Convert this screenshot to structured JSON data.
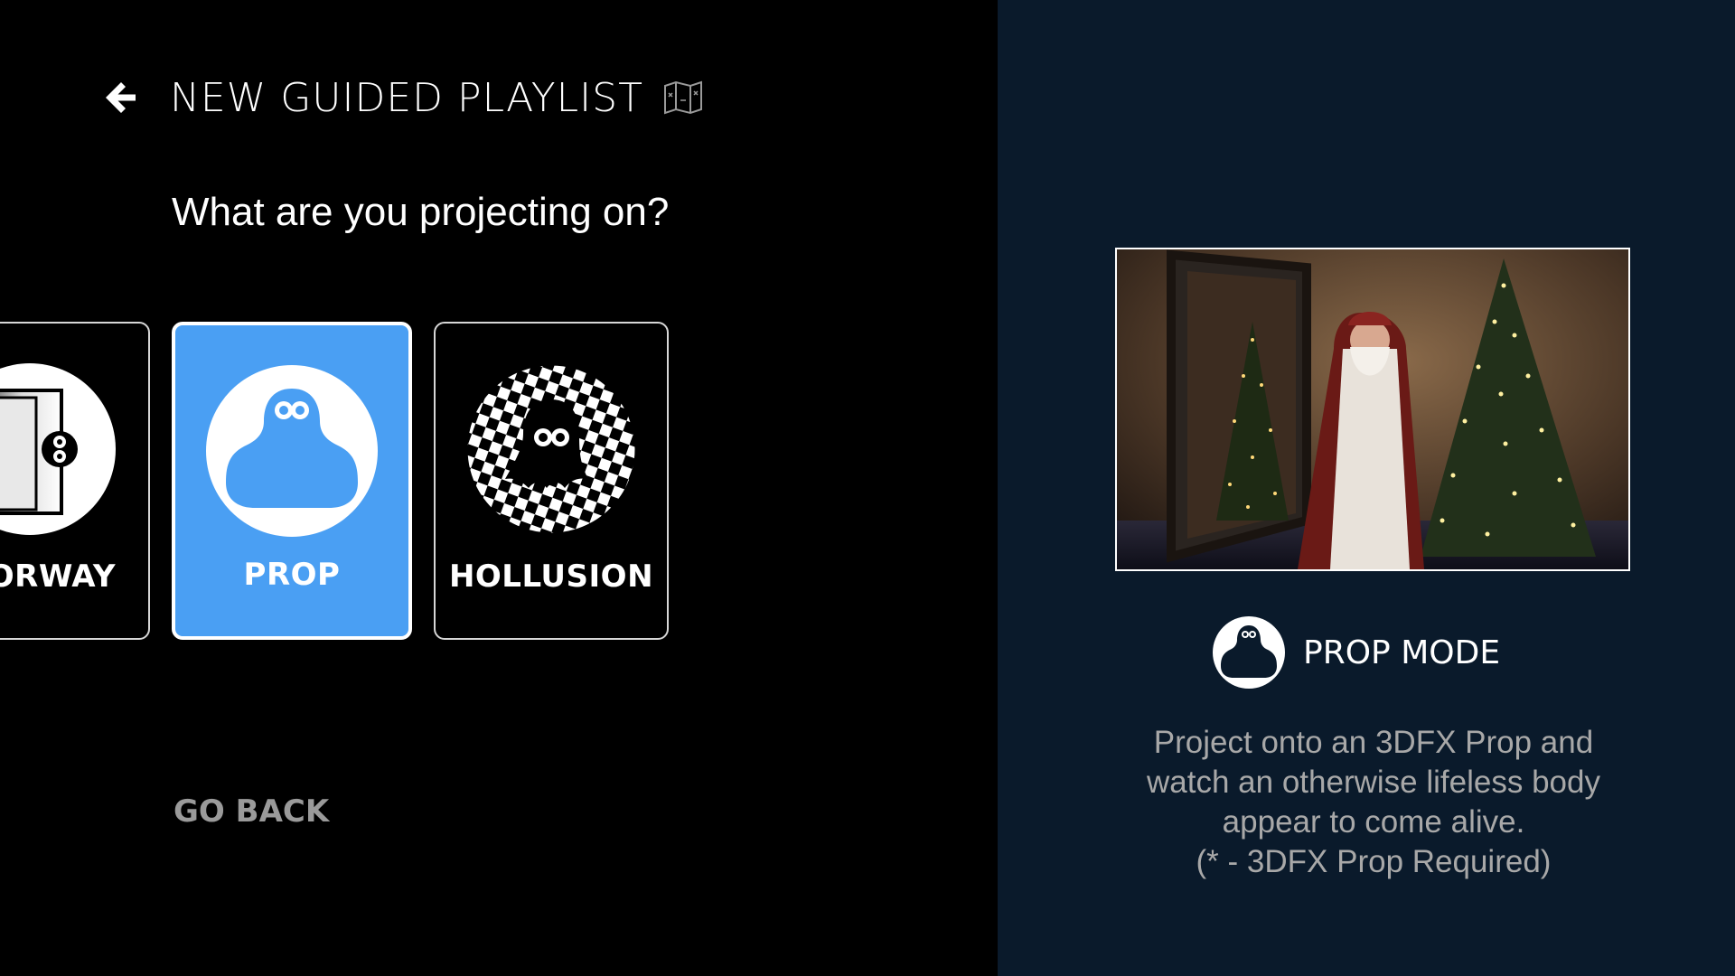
{
  "header": {
    "title": "NEW GUIDED PLAYLIST"
  },
  "question": "What are you projecting on?",
  "cards": [
    {
      "label": "ORWAY",
      "icon": "doorway-icon",
      "selected": false
    },
    {
      "label": "PROP",
      "icon": "ghost-icon",
      "selected": true
    },
    {
      "label": "HOLLUSION",
      "icon": "checkered-ghost-icon",
      "selected": false
    }
  ],
  "go_back_label": "GO BACK",
  "detail": {
    "image": "santa-christmas-trees-preview",
    "mode_title": "PROP MODE",
    "mode_icon": "ghost-icon",
    "description_lines": [
      "Project onto an 3DFX Prop and",
      "watch an otherwise lifeless body",
      "appear to come alive.",
      "(* - 3DFX Prop Required)"
    ]
  },
  "colors": {
    "selected_card": "#4a9ff3",
    "right_panel_bg": "#0a1a2b",
    "muted_text": "#a8a8a8"
  }
}
